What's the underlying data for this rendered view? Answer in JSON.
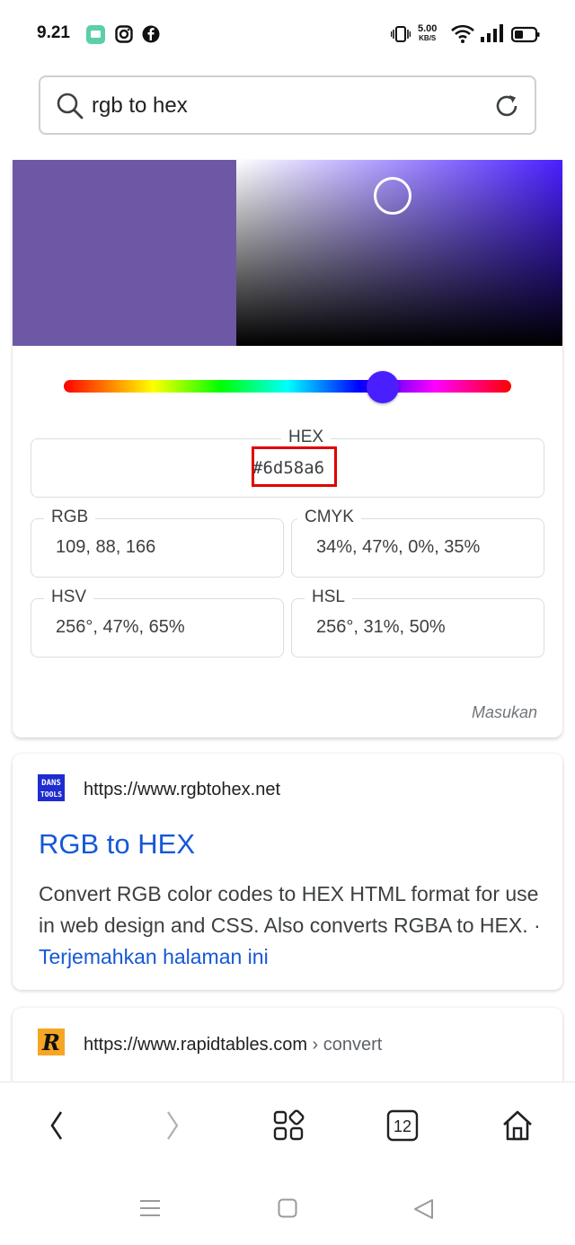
{
  "status_bar": {
    "time": "9.21",
    "network_speed": "5.00",
    "network_unit": "KB/S",
    "left_icons": [
      "chat-app-icon",
      "instagram-icon",
      "facebook-icon"
    ],
    "right_icons": [
      "vibrate-icon",
      "wifi-icon",
      "signal-icon",
      "battery-icon"
    ]
  },
  "search": {
    "query": "rgb to hex"
  },
  "color_picker": {
    "swatch_color": "#6d58a6",
    "hue_color": "#4a1fff",
    "hue_fraction": 0.7,
    "hex_label": "HEX",
    "hex_value": "#6d58a6",
    "rgb_label": "RGB",
    "rgb_value": "109, 88, 166",
    "cmyk_label": "CMYK",
    "cmyk_value": "34%, 47%, 0%, 35%",
    "hsv_label": "HSV",
    "hsv_value": "256°, 47%, 65%",
    "hsl_label": "HSL",
    "hsl_value": "256°, 31%, 50%",
    "feedback_label": "Masukan"
  },
  "results": [
    {
      "url": "https://www.rgbtohex.net",
      "title": "RGB to HEX",
      "snippet": "Convert RGB color codes to HEX HTML format for use in web design and CSS. Also converts RGBA to HEX. · ",
      "translate_link": "Terjemahkan halaman ini",
      "favicon_text": [
        "DANS",
        "TOOLS"
      ]
    },
    {
      "url": "https://www.rapidtables.com",
      "breadcrumb": " › convert",
      "favicon_letter": "R"
    }
  ],
  "bottom_nav": {
    "tab_count": "12"
  },
  "colors": {
    "link_blue": "#1558d6",
    "highlight_red": "#e00000"
  }
}
